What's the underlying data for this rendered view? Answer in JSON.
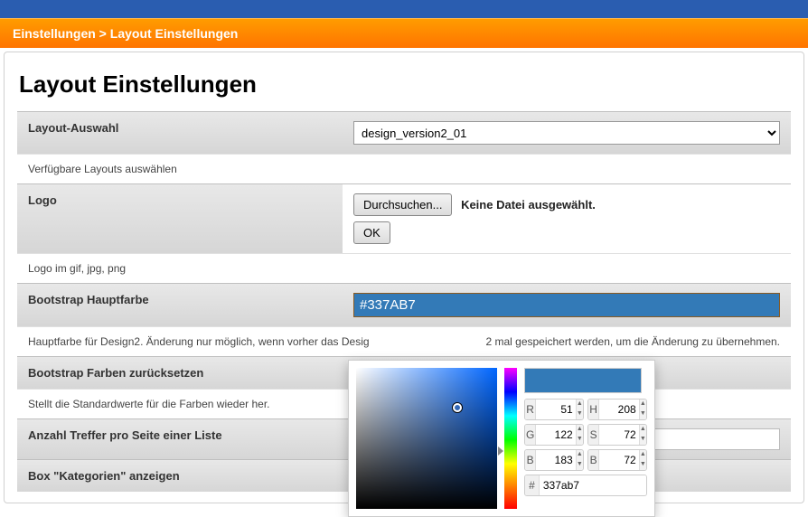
{
  "breadcrumb": {
    "part1": "Einstellungen",
    "sep": " > ",
    "part2": "Layout Einstellungen"
  },
  "page": {
    "title": "Layout Einstellungen"
  },
  "rows": {
    "layout_select": {
      "label": "Layout-Auswahl",
      "value": "design_version2_01",
      "desc": "Verfügbare Layouts auswählen"
    },
    "logo": {
      "label": "Logo",
      "browse": "Durchsuchen...",
      "status": "Keine Datei ausgewählt.",
      "ok": "OK",
      "desc": "Logo im gif, jpg, png"
    },
    "bs_color": {
      "label": "Bootstrap Hauptfarbe",
      "value": "#337AB7",
      "desc_pre": "Hauptfarbe für Design2. Änderung nur möglich, wenn vorher das Desig",
      "desc_post": "2 mal gespeichert werden, um die Änderung zu übernehmen."
    },
    "bs_reset": {
      "label": "Bootstrap Farben zurücksetzen",
      "desc": "Stellt die Standardwerte für die Farben wieder her."
    },
    "per_page": {
      "label": "Anzahl Treffer pro Seite einer Liste"
    },
    "box_cat": {
      "label": "Box \"Kategorien\" anzeigen"
    }
  },
  "colorpicker": {
    "preview": "#337ab7",
    "r": {
      "lab": "R",
      "val": "51"
    },
    "g": {
      "lab": "G",
      "val": "122"
    },
    "b": {
      "lab": "B",
      "val": "183"
    },
    "h": {
      "lab": "H",
      "val": "208"
    },
    "s": {
      "lab": "S",
      "val": "72"
    },
    "v": {
      "lab": "B",
      "val": "72"
    },
    "hex": {
      "lab": "#",
      "val": "337ab7"
    }
  }
}
